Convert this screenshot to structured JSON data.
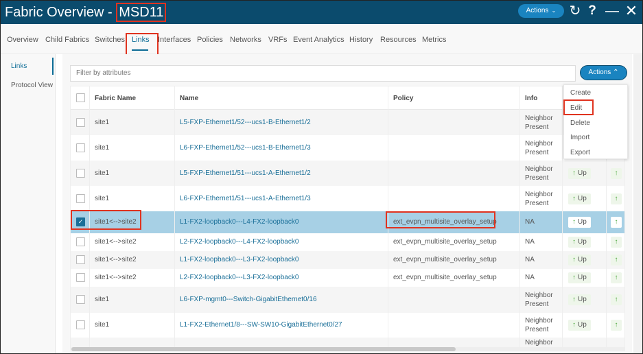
{
  "header": {
    "title": "Fabric Overview - ",
    "fabric_name": "MSD11",
    "actions_label": "Actions",
    "icons": [
      "refresh-icon",
      "help-icon",
      "minimize-icon",
      "close-icon"
    ]
  },
  "tabs": [
    {
      "label": "Overview"
    },
    {
      "label": "Child Fabrics"
    },
    {
      "label": "Switches"
    },
    {
      "label": "Links",
      "active": true
    },
    {
      "label": "Interfaces"
    },
    {
      "label": "Policies"
    },
    {
      "label": "Networks"
    },
    {
      "label": "VRFs"
    },
    {
      "label": "Event Analytics"
    },
    {
      "label": "History"
    },
    {
      "label": "Resources"
    },
    {
      "label": "Metrics"
    }
  ],
  "sidebar": {
    "items": [
      {
        "label": "Links",
        "active": true
      },
      {
        "label": "Protocol View"
      }
    ]
  },
  "toolbar": {
    "filter_placeholder": "Filter by attributes",
    "actions_label": "Actions"
  },
  "actions_menu": {
    "items": [
      "Create",
      "Edit",
      "Delete",
      "Import",
      "Export"
    ],
    "highlighted": "Edit"
  },
  "table": {
    "columns": [
      "Fabric Name",
      "Name",
      "Policy",
      "Info"
    ],
    "rows": [
      {
        "fabric": "site1",
        "name": "L5-FXP-Ethernet1/52---ucs1-B-Ethernet1/2",
        "policy": "",
        "info1": "Neighbor",
        "info2": "Present",
        "status": "",
        "checked": false
      },
      {
        "fabric": "site1",
        "name": "L6-FXP-Ethernet1/52---ucs1-B-Ethernet1/3",
        "policy": "",
        "info1": "Neighbor",
        "info2": "Present",
        "status": "",
        "checked": false
      },
      {
        "fabric": "site1",
        "name": "L5-FXP-Ethernet1/51---ucs1-A-Ethernet1/2",
        "policy": "",
        "info1": "Neighbor",
        "info2": "Present",
        "status": "Up",
        "checked": false
      },
      {
        "fabric": "site1",
        "name": "L6-FXP-Ethernet1/51---ucs1-A-Ethernet1/3",
        "policy": "",
        "info1": "Neighbor",
        "info2": "Present",
        "status": "Up",
        "checked": false
      },
      {
        "fabric": "site1<-->site2",
        "name": "L1-FX2-loopback0---L4-FX2-loopback0",
        "policy": "ext_evpn_multisite_overlay_setup",
        "info1": "NA",
        "info2": "",
        "status": "Up",
        "checked": true
      },
      {
        "fabric": "site1<-->site2",
        "name": "L2-FX2-loopback0---L4-FX2-loopback0",
        "policy": "ext_evpn_multisite_overlay_setup",
        "info1": "NA",
        "info2": "",
        "status": "Up",
        "checked": false
      },
      {
        "fabric": "site1<-->site2",
        "name": "L1-FX2-loopback0---L3-FX2-loopback0",
        "policy": "ext_evpn_multisite_overlay_setup",
        "info1": "NA",
        "info2": "",
        "status": "Up",
        "checked": false
      },
      {
        "fabric": "site1<-->site2",
        "name": "L2-FX2-loopback0---L3-FX2-loopback0",
        "policy": "ext_evpn_multisite_overlay_setup",
        "info1": "NA",
        "info2": "",
        "status": "Up",
        "checked": false
      },
      {
        "fabric": "site1",
        "name": "L6-FXP-mgmt0---Switch-GigabitEthernet0/16",
        "policy": "",
        "info1": "Neighbor",
        "info2": "Present",
        "status": "Up",
        "checked": false
      },
      {
        "fabric": "site1",
        "name": "L1-FX2-Ethernet1/8---SW-SW10-GigabitEthernet0/27",
        "policy": "",
        "info1": "Neighbor",
        "info2": "Present",
        "status": "Up",
        "checked": false
      },
      {
        "fabric": "",
        "name": "",
        "policy": "",
        "info1": "Neighbor",
        "info2": "",
        "status": "",
        "checked": false
      }
    ]
  },
  "colors": {
    "header_bg": "#0b4b6d",
    "accent": "#1a84c0",
    "link": "#1a6f98",
    "selected_row": "#a7d0e5",
    "highlight_box": "#e0331f",
    "status_up": "#4aa83b"
  }
}
